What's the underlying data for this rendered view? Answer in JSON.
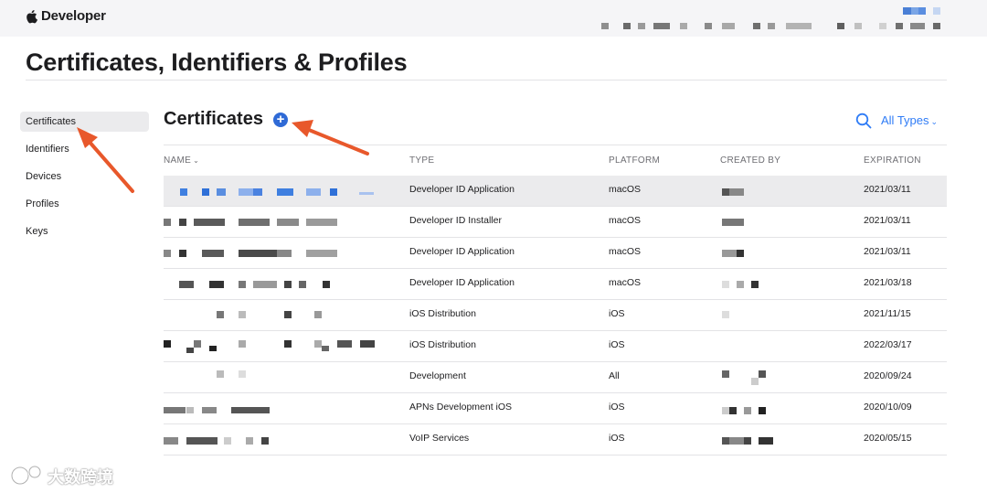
{
  "header": {
    "brand": "Developer",
    "logo_icon": "apple-logo-icon"
  },
  "page": {
    "title": "Certificates, Identifiers & Profiles"
  },
  "sidebar": {
    "items": [
      {
        "label": "Certificates",
        "active": true
      },
      {
        "label": "Identifiers",
        "active": false
      },
      {
        "label": "Devices",
        "active": false
      },
      {
        "label": "Profiles",
        "active": false
      },
      {
        "label": "Keys",
        "active": false
      }
    ]
  },
  "section": {
    "title": "Certificates",
    "add_icon": "plus-circle-icon",
    "search_icon": "search-icon",
    "filter_label": "All Types",
    "filter_chevron": "⌄"
  },
  "table": {
    "columns": {
      "name": "NAME",
      "type": "TYPE",
      "platform": "PLATFORM",
      "created_by": "CREATED BY",
      "expiration": "EXPIRATION"
    },
    "rows": [
      {
        "type": "Developer ID Application",
        "platform": "macOS",
        "expiration": "2021/03/11",
        "selected": true
      },
      {
        "type": "Developer ID Installer",
        "platform": "macOS",
        "expiration": "2021/03/11"
      },
      {
        "type": "Developer ID Application",
        "platform": "macOS",
        "expiration": "2021/03/11"
      },
      {
        "type": "Developer ID Application",
        "platform": "macOS",
        "expiration": "2021/03/18"
      },
      {
        "type": "iOS Distribution",
        "platform": "iOS",
        "expiration": "2021/11/15"
      },
      {
        "type": "iOS Distribution",
        "platform": "iOS",
        "expiration": "2022/03/17"
      },
      {
        "type": "Development",
        "platform": "All",
        "expiration": "2020/09/24"
      },
      {
        "type": "APNs Development iOS",
        "platform": "iOS",
        "expiration": "2020/10/09"
      },
      {
        "type": "VoIP Services",
        "platform": "iOS",
        "expiration": "2020/05/15"
      }
    ]
  },
  "annotations": {
    "arrow_color": "#e8582b"
  },
  "watermark": {
    "text": "大数跨境"
  },
  "colors": {
    "accent": "#2f7cf6",
    "add_button": "#2f6ad6",
    "selected_row": "#ebebed"
  }
}
